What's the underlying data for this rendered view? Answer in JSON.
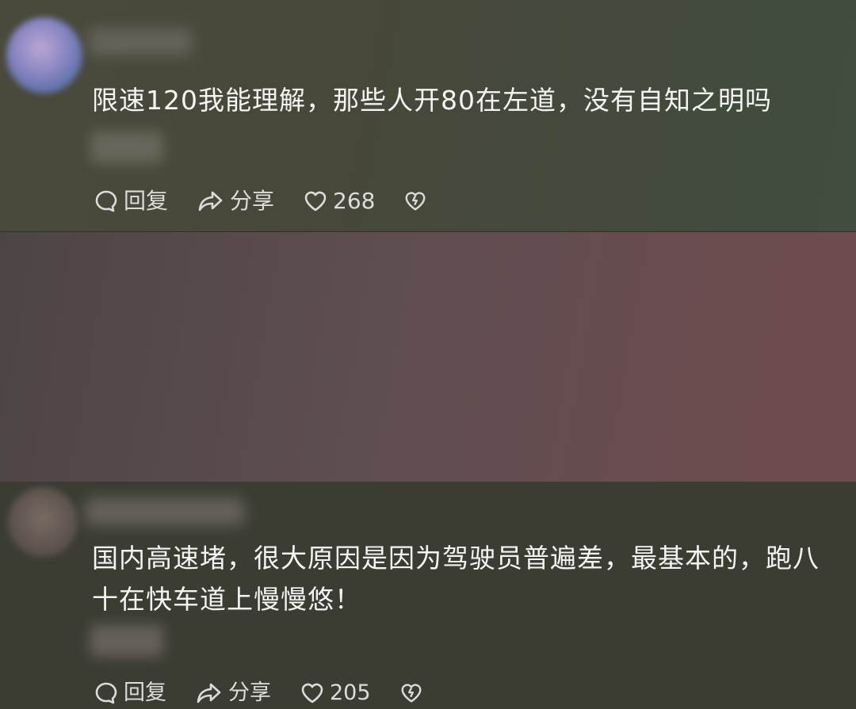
{
  "comments": [
    {
      "text": "限速120我能理解，那些人开80在左道，没有自知之明吗",
      "actions": {
        "reply": "回复",
        "share": "分享",
        "likes": "268"
      }
    },
    {
      "text": "国内高速堵，很大原因是因为驾驶员普遍差，最基本的，跑八十在快车道上慢慢悠！",
      "actions": {
        "reply": "回复",
        "share": "分享",
        "likes": "205"
      }
    }
  ],
  "colors": {
    "text": "#f4f4f4",
    "action_text": "#dcdcdc",
    "comment1_bg": "#47473a",
    "comment2_bg": "#5f4e50"
  },
  "icons": [
    "reply-icon",
    "share-icon",
    "heart-icon",
    "broken-heart-icon"
  ]
}
